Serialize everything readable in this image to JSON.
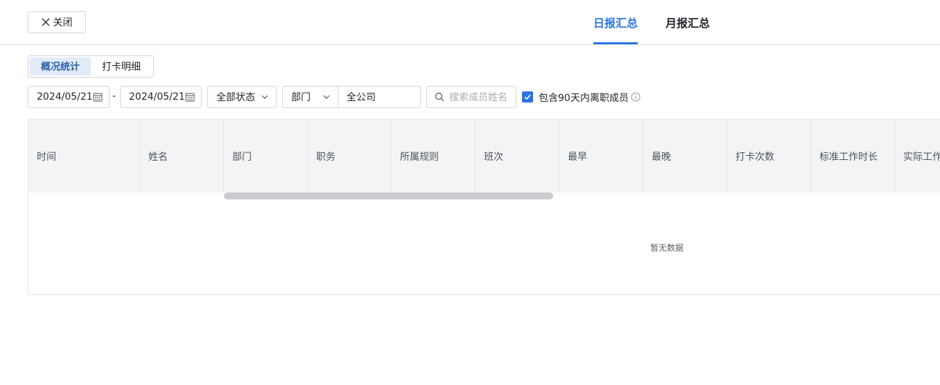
{
  "header": {
    "close_label": "关闭",
    "tabs": [
      {
        "label": "日报汇总",
        "active": true
      },
      {
        "label": "月报汇总",
        "active": false
      }
    ],
    "accent_color": "#2b73e6"
  },
  "segments": [
    {
      "label": "概况统计",
      "active": true
    },
    {
      "label": "打卡明细",
      "active": false
    }
  ],
  "filters": {
    "start_date": "2024/05/21",
    "date_separator": "-",
    "end_date": "2024/05/21",
    "status": "全部状态",
    "dept_type": "部门",
    "dept_value": "全公司",
    "search_placeholder": "搜索成员姓名",
    "include_left_label": "包含90天内离职成员",
    "include_left_checked": true
  },
  "table": {
    "columns": [
      "时间",
      "姓名",
      "部门",
      "职务",
      "所属规则",
      "班次",
      "最早",
      "最晚",
      "打卡次数",
      "标准工作时长",
      "实际工作时长"
    ],
    "rows": [],
    "empty_text": "暂无数据"
  }
}
